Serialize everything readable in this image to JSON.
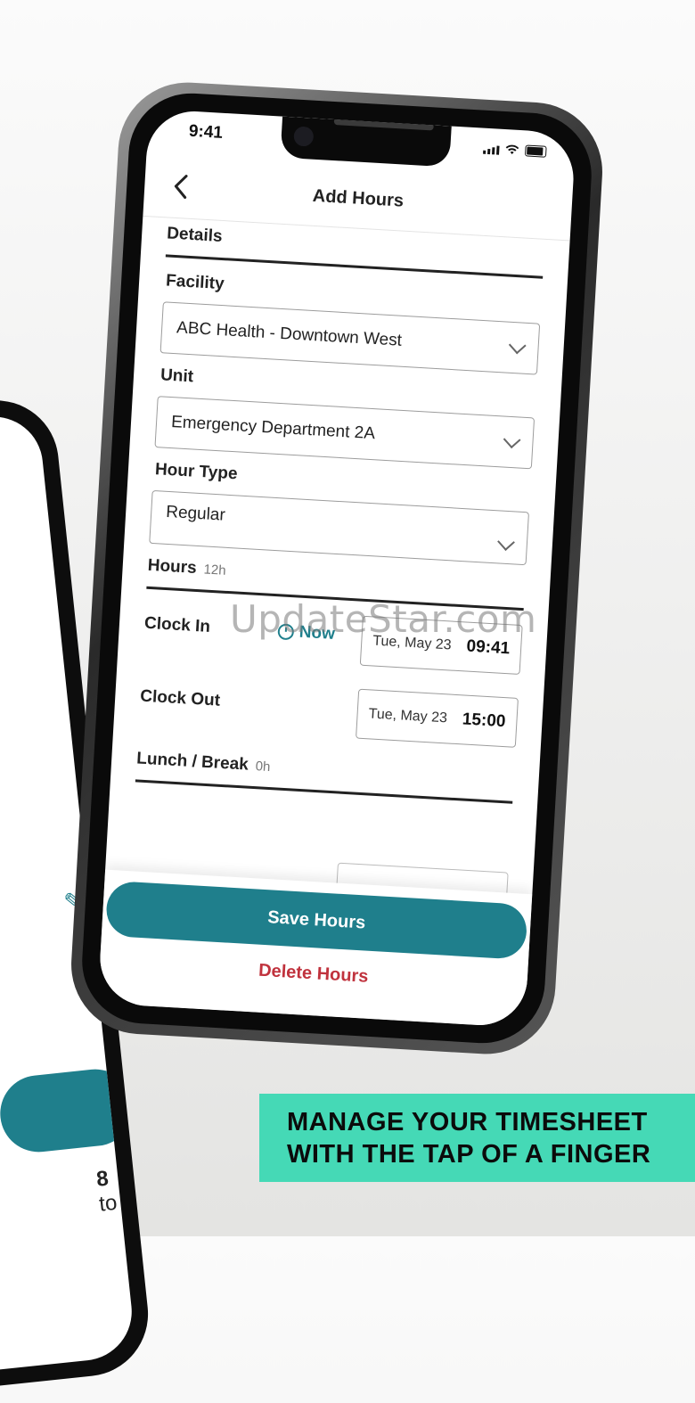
{
  "status_bar": {
    "time": "9:41"
  },
  "nav": {
    "title": "Add Hours"
  },
  "details": {
    "section_title": "Details"
  },
  "facility": {
    "label": "Facility",
    "value": "ABC Health - Downtown West"
  },
  "unit": {
    "label": "Unit",
    "value": "Emergency Department 2A"
  },
  "hour_type": {
    "label": "Hour Type",
    "value": "Regular"
  },
  "hours": {
    "section_title": "Hours",
    "total": "12h"
  },
  "clock_in": {
    "label": "Clock In",
    "now_label": "Now",
    "date": "Tue, May 23",
    "time": "09:41"
  },
  "clock_out": {
    "label": "Clock Out",
    "date": "Tue, May 23",
    "time": "15:00"
  },
  "lunch": {
    "section_title": "Lunch / Break",
    "total": "0h"
  },
  "actions": {
    "save_label": "Save Hours",
    "delete_label": "Delete Hours"
  },
  "left_phone": {
    "text_bold": "8",
    "text": " to"
  },
  "watermark": "UpdateStar.com",
  "promo": {
    "line1": "MANAGE YOUR TIMESHEET",
    "line2": "WITH THE TAP OF A FINGER"
  },
  "colors": {
    "accent": "#1f7f8c",
    "danger": "#c0323d",
    "promo_bg": "#45d9b6"
  }
}
